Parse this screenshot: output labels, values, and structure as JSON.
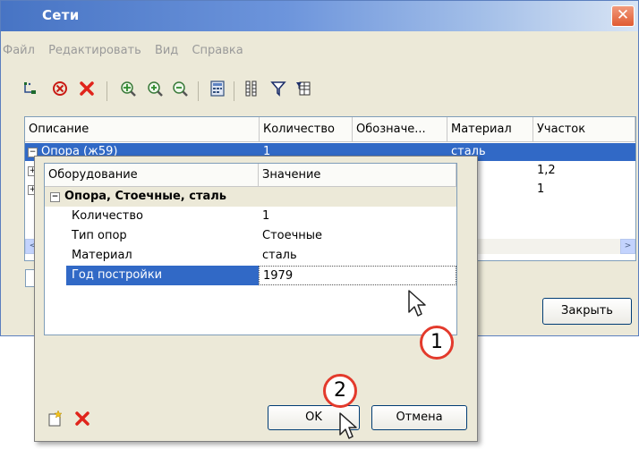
{
  "window": {
    "title": "Сети",
    "close_glyph": "✕",
    "menu": [
      "Файл",
      "Редактировать",
      "Вид",
      "Справка"
    ],
    "toolbar_icons": [
      "tree-icon",
      "circle-x-icon",
      "delete-icon",
      "zoom-fit-icon",
      "zoom-in-icon",
      "zoom-out-icon",
      "calculator-icon",
      "columns-icon",
      "filter-icon",
      "table-filter-icon"
    ],
    "grid": {
      "columns": [
        "Описание",
        "Количество",
        "Обозначе...",
        "Материал",
        "Участок"
      ],
      "rows": [
        {
          "description": "Опора (ж59)",
          "quantity": "1",
          "designation": "",
          "material": "сталь",
          "section": ""
        },
        {
          "description": "",
          "quantity": "",
          "designation": "",
          "material": "ь",
          "section": "1,2"
        },
        {
          "description": "",
          "quantity": "",
          "designation": "",
          "material": "ь",
          "section": "1"
        }
      ]
    },
    "close_button": "Закрыть",
    "scroll_left": "<",
    "scroll_right": ">"
  },
  "dialog": {
    "columns": [
      "Оборудование",
      "Значение"
    ],
    "category": "Опора, Стоечные, сталь",
    "properties": [
      {
        "name": "Количество",
        "value": "1"
      },
      {
        "name": "Тип опор",
        "value": "Стоечные"
      },
      {
        "name": "Материал",
        "value": "сталь"
      },
      {
        "name": "Год постройки",
        "value": "1979"
      }
    ],
    "ok_label": "OK",
    "cancel_label": "Отмена"
  },
  "markers": [
    "1",
    "2"
  ],
  "colors": {
    "title_gradient_start": "#4774c4",
    "selection": "#3169c6",
    "window_bg": "#ece9d8",
    "marker_border": "#e33a2c",
    "delete_red": "#e0241b"
  }
}
